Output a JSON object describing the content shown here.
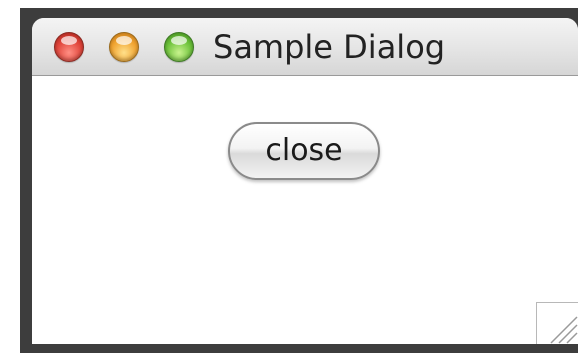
{
  "window": {
    "title": "Sample Dialog",
    "traffic_lights": [
      {
        "name": "close-light",
        "color": "#e0443a"
      },
      {
        "name": "minimize-light",
        "color": "#f0a330"
      },
      {
        "name": "zoom-light",
        "color": "#6cc23a"
      }
    ]
  },
  "content": {
    "close_button_label": "close"
  },
  "icons": {
    "resize_grip": "resize-grip-icon"
  }
}
